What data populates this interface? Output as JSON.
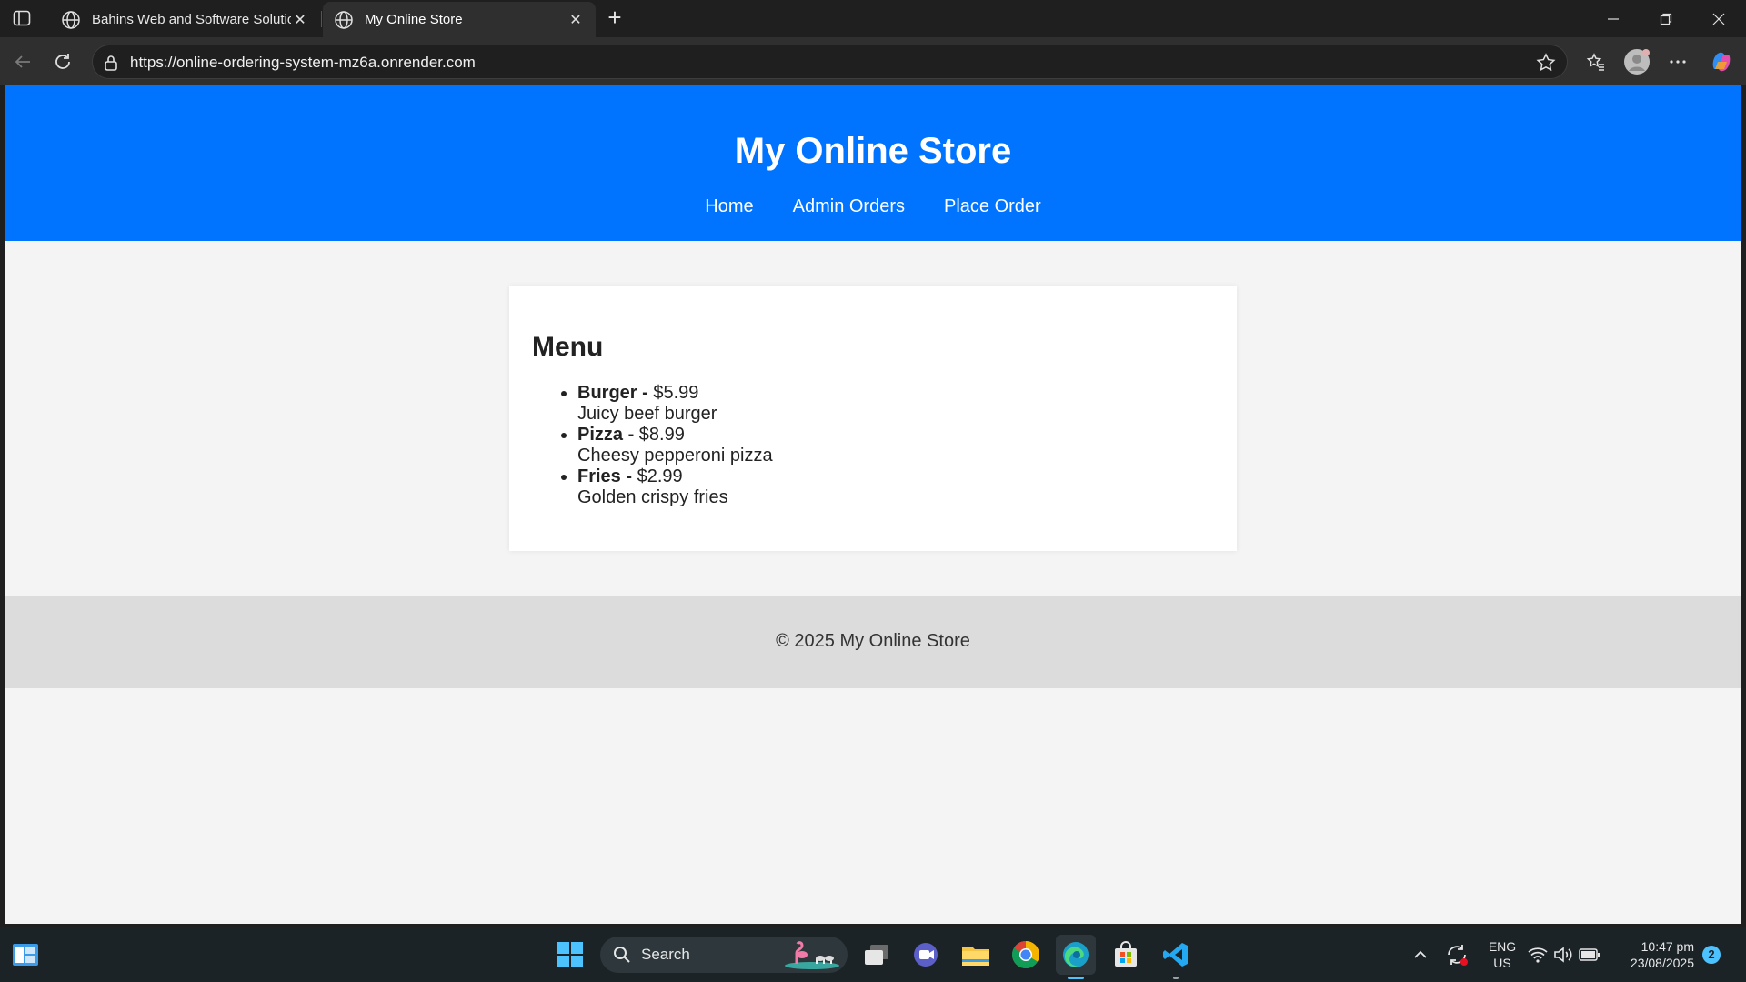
{
  "browser": {
    "tabs": [
      {
        "title": "Bahins Web and Software Solutions",
        "active": false
      },
      {
        "title": "My Online Store",
        "active": true
      }
    ],
    "url": "https://online-ordering-system-mz6a.onrender.com"
  },
  "site": {
    "title": "My Online Store",
    "nav": [
      "Home",
      "Admin Orders",
      "Place Order"
    ],
    "menu": {
      "heading": "Menu",
      "items": [
        {
          "name": "Burger",
          "sep": " -",
          "price": " $5.99",
          "description": "Juicy beef burger"
        },
        {
          "name": "Pizza",
          "sep": " -",
          "price": " $8.99",
          "description": "Cheesy pepperoni pizza"
        },
        {
          "name": "Fries",
          "sep": " -",
          "price": " $2.99",
          "description": "Golden crispy fries"
        }
      ]
    },
    "footer": "© 2025 My Online Store",
    "colors": {
      "header": "#0074ff",
      "footer": "#dcdcdc",
      "page": "#f4f4f4"
    }
  },
  "taskbar": {
    "search_label": "Search",
    "language": {
      "line1": "ENG",
      "line2": "US"
    },
    "time": "10:47 pm",
    "date": "23/08/2025",
    "notification_count": "2",
    "apps": [
      "start-icon",
      "task-view-icon",
      "teams-icon",
      "file-explorer-icon",
      "chrome-icon",
      "edge-icon",
      "store-icon",
      "vscode-icon"
    ]
  }
}
